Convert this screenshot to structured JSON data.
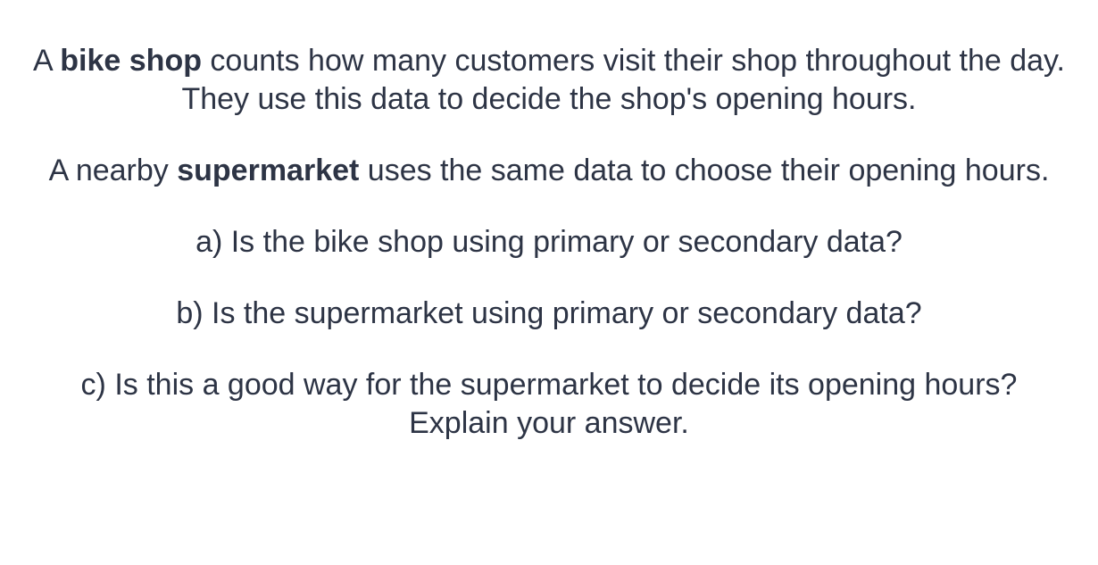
{
  "question": {
    "intro": {
      "prefix": "A ",
      "bold": "bike shop",
      "suffix": " counts how many customers visit their shop throughout the day."
    },
    "intro_second": "They use this data to decide the shop's opening hours.",
    "supermarket": {
      "prefix": "A nearby ",
      "bold": "supermarket",
      "suffix": " uses the same data to choose their opening hours."
    },
    "part_a": "a) Is the bike shop using primary or secondary data?",
    "part_b": "b) Is the supermarket using primary or secondary data?",
    "part_c_line1": "c) Is this a good way for the supermarket to decide its opening hours?",
    "part_c_line2": "Explain your answer."
  }
}
